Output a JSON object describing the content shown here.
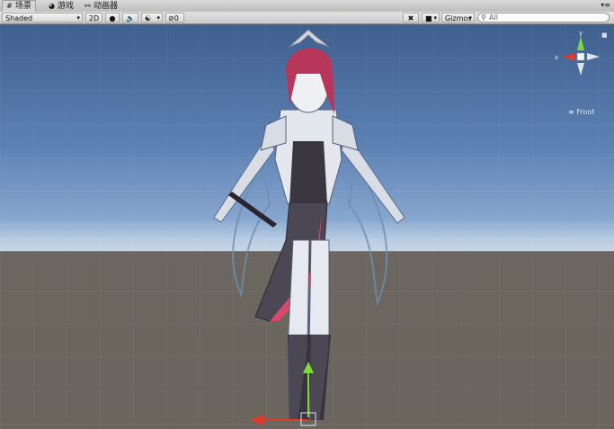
{
  "tabs": [
    {
      "label": "场景",
      "icon": "hash-icon",
      "active": true
    },
    {
      "label": "游戏",
      "icon": "pacman-icon",
      "active": false
    },
    {
      "label": "动画器",
      "icon": "animator-icon",
      "active": false
    }
  ],
  "toolbar": {
    "shading_mode": "Shaded",
    "mode_2d": "2D",
    "hidden_count": "0",
    "gizmos_label": "Gizmos",
    "search_placeholder": "All"
  },
  "orientation": {
    "x_label": "x",
    "y_label": "y",
    "view_label": "Front"
  },
  "colors": {
    "x_axis": "#e13a2a",
    "y_axis": "#7ed83a",
    "z_axis": "#3a6be1"
  }
}
